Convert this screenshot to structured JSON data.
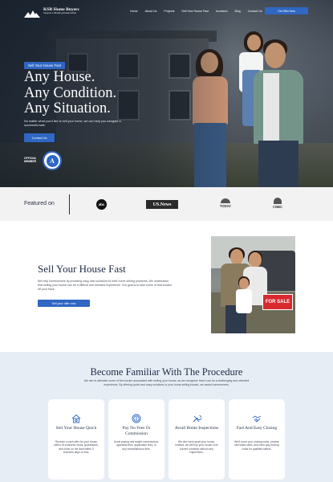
{
  "brand": {
    "name": "KSR Home Buyers",
    "tagline": "Integrity in Building Relationships"
  },
  "nav": {
    "links": [
      "Home",
      "About Us",
      "Projects",
      "Sell Your House Fast",
      "Investors",
      "Blog",
      "Contact Us"
    ],
    "cta": "Get Offer Now"
  },
  "hero": {
    "badge": "Sell Your House Fast",
    "title_lines": [
      "Any House.",
      "Any Condition.",
      "Any Situation."
    ],
    "subtitle": "No matter what you'd like to sell your home, we can help you navigate a successful sale.",
    "button": "Contact Us",
    "official_label": "OFFICIAL MEMBER",
    "seal_letter": "A"
  },
  "featured": {
    "label": "Featured on",
    "logos": [
      "abc",
      "US.News",
      "TODAY",
      "CNBC"
    ]
  },
  "sell": {
    "title": "Sell Your House Fast",
    "description": "We help homeowners by providing easy, fast solutions for their home selling problems. We understand that selling your house can be a difficult and stressful experience. Our goal is to take some of that burden off your back.",
    "button": "Sell your offer now",
    "sign_text": "FOR SALE"
  },
  "procedure": {
    "title": "Become Familiar With The Procedure",
    "description": "We aim to alleviate some of the burden associated with selling your house, as we recognize that it can be a challenging and stressful experience. By offering quick and easy solutions to your home selling issues, we assist homeowners.",
    "cards": [
      {
        "icon": "house-money-icon",
        "title": "Sell Your House Quick",
        "text": "Receive a cash offer for your house within 24 business hours, guaranteed, and close on the deal within 3 business days or less."
      },
      {
        "icon": "dollar-coin-icon",
        "title": "Pay No Fees Or Commission",
        "text": "Avoid paying real estate commissions, appraisal fees, application fees, or any miscellaneous fees."
      },
      {
        "icon": "tools-icon",
        "title": "Avoid Home Inspections",
        "text": "We don't pick apart your house. Instead, we will buy your house in its current condition without any inspections."
      },
      {
        "icon": "handshake-icon",
        "title": "Fast And Easy Closing",
        "text": "We'll cover your closing costs, provide fast sales rates, and even pay moving costs for qualified sellers."
      }
    ]
  },
  "colors": {
    "accent": "#2f67c3",
    "dark_text": "#1f2a44",
    "section_bg": "#e6edf5"
  }
}
